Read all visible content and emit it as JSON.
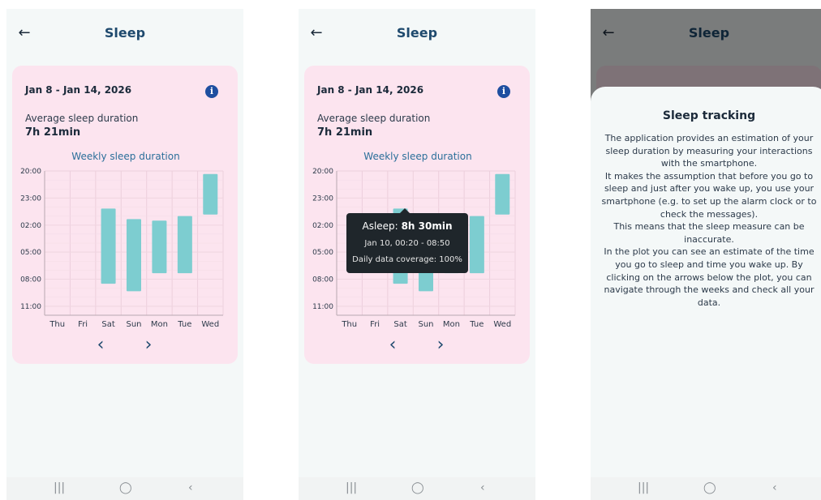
{
  "screens": [
    {
      "title": "Sleep",
      "date_range": "Jan 8 - Jan 14, 2026",
      "avg_label": "Average sleep duration",
      "avg_value": "7h  21min",
      "chart_title": "Weekly sleep duration"
    },
    {
      "title": "Sleep",
      "date_range": "Jan 8 - Jan 14, 2026",
      "avg_label": "Average sleep duration",
      "avg_value": "7h  21min",
      "chart_title": "Weekly sleep duration",
      "tooltip": {
        "asleep_label": "Asleep:",
        "asleep_value": "8h  30min",
        "range": "Jan 10, 00:20 - 08:50",
        "coverage": "Daily data coverage: 100%"
      }
    },
    {
      "title": "Sleep",
      "sheet": {
        "title": "Sleep tracking",
        "paragraphs": [
          "The application provides an estimation of your sleep duration by measuring your interactions with the smartphone.",
          "It makes the assumption that before you go to sleep and just after you wake up, you use your smartphone (e.g. to set up the alarm clock or to check the messages).",
          "This means that the sleep measure can be inaccurate.",
          "In the plot you can see an estimate of the time you go to sleep and time you wake up. By clicking on the arrows below the plot, you can navigate through the weeks and check all your data."
        ]
      }
    }
  ],
  "icons": {
    "back": "arrow-left-icon",
    "info": "info-icon",
    "prev": "chevron-left-icon",
    "next": "chevron-right-icon",
    "nav_recents": "recents-icon",
    "nav_home": "home-icon",
    "nav_back": "back-nav-icon"
  },
  "glyphs": {
    "back": "←",
    "info": "i",
    "prev": "‹",
    "next": "›",
    "nav_recents": "|||",
    "nav_home": "◯",
    "nav_back": "‹"
  },
  "colors": {
    "card": "#fce4ef",
    "bar": "#7dcdd0",
    "title": "#1f4a6e",
    "info": "#1f4fa0"
  },
  "chart_data": {
    "type": "bar",
    "title": "Weekly sleep duration",
    "categories": [
      "Thu",
      "Fri",
      "Sat",
      "Sun",
      "Mon",
      "Tue",
      "Wed"
    ],
    "y_ticks": [
      "20:00",
      "23:00",
      "02:00",
      "05:00",
      "08:00",
      "11:00"
    ],
    "ylim_hours_after_20": [
      0,
      16
    ],
    "series": [
      {
        "bars": [
          null,
          null,
          {
            "start": "00:10",
            "end": "08:30"
          },
          {
            "start": "01:20",
            "end": "09:20"
          },
          {
            "start": "01:30",
            "end": "07:20"
          },
          {
            "start": "01:00",
            "end": "07:20"
          },
          {
            "start": "20:20",
            "end": "00:50"
          }
        ]
      }
    ],
    "grid": true
  }
}
